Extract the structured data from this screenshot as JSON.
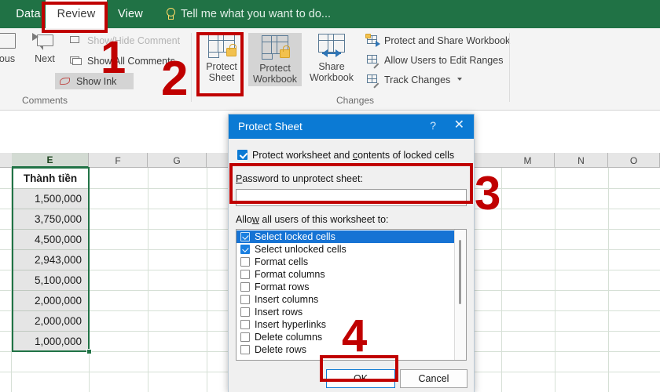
{
  "ribbon": {
    "tabs": [
      {
        "label": "Data",
        "active": false
      },
      {
        "label": "Review",
        "active": true
      },
      {
        "label": "View",
        "active": false
      }
    ],
    "tell_me": "Tell me what you want to do...",
    "comments_group": {
      "label": "Comments",
      "previous": "ous",
      "next": "Next",
      "show_hide_comment": "Show/Hide Comment",
      "show_all_comments": "Show All Comments",
      "show_ink": "Show Ink"
    },
    "changes_group": {
      "label": "Changes",
      "protect_sheet": [
        "Protect",
        "Sheet"
      ],
      "protect_workbook": [
        "Protect",
        "Workbook"
      ],
      "share_workbook": [
        "Share",
        "Workbook"
      ],
      "protect_and_share_workbook": "Protect and Share Workbook",
      "allow_users_to_edit_ranges": "Allow Users to Edit Ranges",
      "track_changes": "Track Changes"
    }
  },
  "sheet": {
    "column_headers": [
      "E",
      "F",
      "G",
      "M",
      "N",
      "O"
    ],
    "selected_column": "E",
    "column_e": {
      "header": "Thành tiền",
      "values": [
        "1,500,000",
        "3,750,000",
        "4,500,000",
        "2,943,000",
        "5,100,000",
        "2,000,000",
        "2,000,000",
        "1,000,000"
      ]
    }
  },
  "dialog": {
    "title": "Protect Sheet",
    "help_glyph": "?",
    "close_glyph": "✕",
    "protect_checkbox": {
      "checked": true,
      "label_pre": "Protect worksheet and ",
      "label_accel": "c",
      "label_post": "ontents of locked cells"
    },
    "password_label_accel": "P",
    "password_label_rest": "assword to unprotect sheet:",
    "password_value": "",
    "allow_label_pre": "Allo",
    "allow_label_accel": "w",
    "allow_label_post": " all users of this worksheet to:",
    "permissions": [
      {
        "label": "Select locked cells",
        "checked": true,
        "selected": true
      },
      {
        "label": "Select unlocked cells",
        "checked": true,
        "selected": false
      },
      {
        "label": "Format cells",
        "checked": false,
        "selected": false
      },
      {
        "label": "Format columns",
        "checked": false,
        "selected": false
      },
      {
        "label": "Format rows",
        "checked": false,
        "selected": false
      },
      {
        "label": "Insert columns",
        "checked": false,
        "selected": false
      },
      {
        "label": "Insert rows",
        "checked": false,
        "selected": false
      },
      {
        "label": "Insert hyperlinks",
        "checked": false,
        "selected": false
      },
      {
        "label": "Delete columns",
        "checked": false,
        "selected": false
      },
      {
        "label": "Delete rows",
        "checked": false,
        "selected": false
      }
    ],
    "ok_label": "OK",
    "cancel_label": "Cancel"
  },
  "annotations": {
    "steps": [
      "1",
      "2",
      "3",
      "4"
    ],
    "color": "#c00000"
  }
}
